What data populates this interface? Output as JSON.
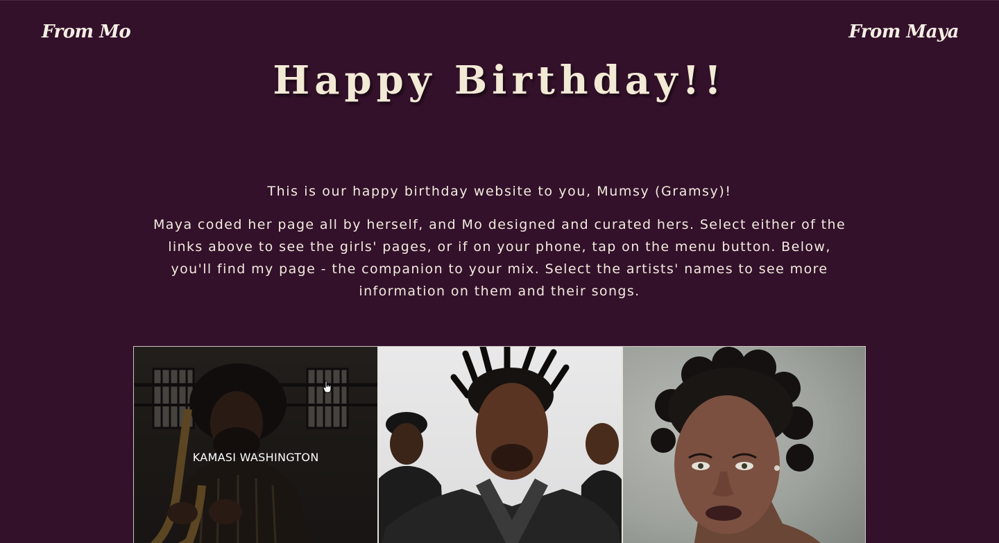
{
  "nav": {
    "left_label": "From Mo",
    "right_label": "From Maya"
  },
  "header": {
    "title": "Happy Birthday!!"
  },
  "intro": {
    "greeting": "This is our happy birthday website to you, Mumsy (Gramsy)!",
    "description": "Maya coded her page all by herself, and Mo designed and curated hers. Select either of the links above to see the girls' pages, or if on your phone, tap on the menu button. Below, you'll find my page - the companion to your mix. Select the artists' names to see more information on them and their songs."
  },
  "gallery": {
    "cards": [
      {
        "label": "KAMASI WASHINGTON",
        "image": "kamasi-washington-photo"
      },
      {
        "label": "",
        "image": "q-tip-group-photo"
      },
      {
        "label": "",
        "image": "rihanna-portrait-photo"
      }
    ]
  },
  "colors": {
    "background": "#33112a",
    "text": "#f3ece0",
    "border": "#cfc6c3"
  }
}
